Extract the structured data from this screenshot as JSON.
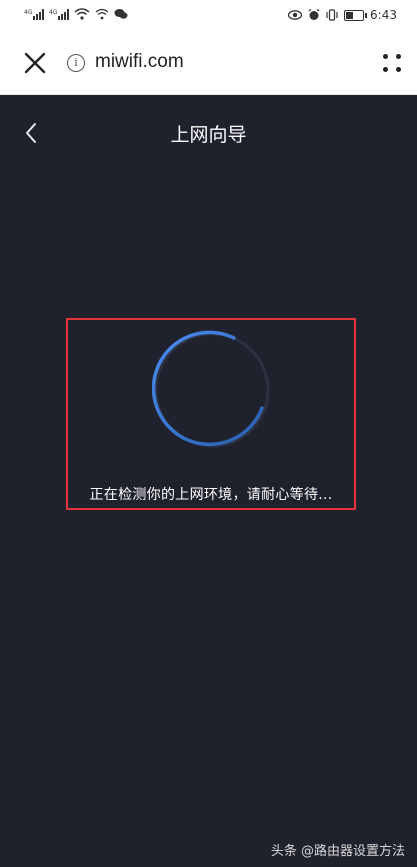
{
  "status_bar": {
    "time": "6:43",
    "left_icons": [
      "signal-icon",
      "signal-icon",
      "wifi-icon",
      "wechat-icon"
    ],
    "right_icons": [
      "eye-icon",
      "alarm-icon",
      "vibrate-icon",
      "battery-icon"
    ],
    "battery_level": 0.45
  },
  "browser": {
    "url": "miwifi.com"
  },
  "app": {
    "title": "上网向导"
  },
  "loading": {
    "message": "正在检测你的上网环境，请耐心等待..."
  },
  "watermark": {
    "text": "头条 @路由器设置方法"
  },
  "colors": {
    "background": "#1f212d",
    "spinner": "#3d7fe0",
    "highlight_border": "#e5343d"
  }
}
